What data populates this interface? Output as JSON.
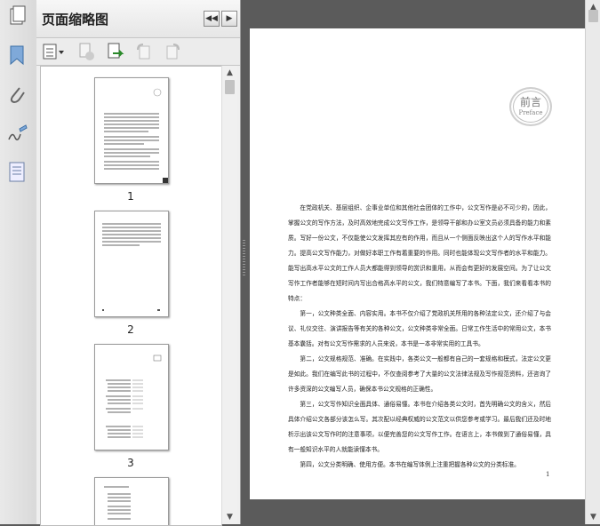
{
  "panel": {
    "title": "页面缩略图",
    "collapse_label": "◀◀",
    "expand_label": "▶"
  },
  "thumbnails": [
    {
      "number": "1"
    },
    {
      "number": "2"
    },
    {
      "number": "3"
    }
  ],
  "document": {
    "preface_cn": "前言",
    "preface_en": "Preface",
    "paragraphs": [
      "在党政机关、基层组织、企事业单位和其他社会团体的工作中，公文写作是必不可少的，因此，掌握公文的写作方法，及时高效地完成公文写作工作，是领导干部和办公室文员必须具备的能力和素质。写好一份公文，不仅能使公文发挥其应有的作用，而且从一个侧面反映出这个人的写作水平和能力。提高公文写作能力，对做好本职工作有着重要的作用。同时也能体现公文写作者的水平和能力。能写出高水平公文的工作人员大都能得到领导的赏识和重用，从而会有更好的发展空间。为了让公文写作工作者能够在短时间内写出合格高水平的公文，我们特意编写了本书。下面，我们来看看本书的特点：",
      "第一，公文种类全面、内容实用。本书不仅介绍了党政机关所用的各种法定公文，还介绍了与会议、礼仪交往、演讲报告等有关的各种公文，公文种类非常全面。日常工作生活中的常用公文，本书基本囊括。对有公文写作需求的人员来说，本书是一本非常实用的工具书。",
      "第二，公文规格规范、准确。在实践中，各类公文一般都有自己的一套规格和模式，法定公文更是如此。我们在编写此书的过程中，不仅查阅参考了大量的公文法律法规及写作规范资料，还咨询了许多资深的公文编写人员，确保本书公文规格的正确性。",
      "第三，公文写作知识全面具体、通俗易懂。本书在介绍各类公文时，首先明确公文的含义，然后具体介绍公文各部分该怎么写。其次配以经典权威的公文范文以供您参考或学习。最后我们还及时地析示出该公文写作时的注意事项，以便完善您的公文写作工作。在语言上，本书做到了通俗易懂，具有一般知识水平的人就能读懂本书。",
      "第四，公文分类明确、使用方便。本书在编写体例上注重把握各种公文的分类标准。"
    ],
    "page_number": "1"
  }
}
